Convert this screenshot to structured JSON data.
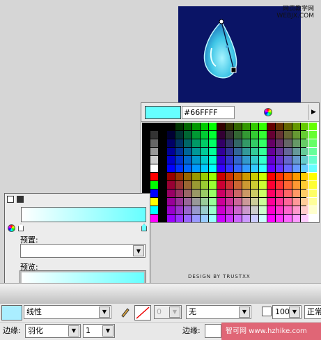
{
  "watermark_top": {
    "line1": "网页教学网",
    "line2": "WEBJX.COM"
  },
  "swatch_panel": {
    "hex_value": "#66FFFF",
    "preview_color": "#66ffff",
    "left_column_colors": [
      "#000000",
      "#333333",
      "#666666",
      "#999999",
      "#cccccc",
      "#ffffff",
      "#ff0000",
      "#00ff00",
      "#0000ff",
      "#ffff00",
      "#00ffff",
      "#ff00ff"
    ],
    "icons": {
      "wheel": "color-wheel-icon",
      "menu": "panel-menu-icon"
    }
  },
  "fill_panel": {
    "preset_label": "预置:",
    "preset_value": "",
    "preview_label": "预览:",
    "gradient_start": "#ffffff",
    "gradient_end": "#66ffff"
  },
  "design_credit": "DESIGN BY TRUSTXX",
  "toolbar": {
    "fill_type": "线性",
    "stroke_width": "0",
    "stroke_style": "无",
    "opacity": "100",
    "blend_mode": "正常",
    "edge_label": "边缘:",
    "edge_value": "羽化",
    "edge_amount": "1",
    "edge_label_right": "边缘:"
  },
  "bottom_watermark": "智可网  www.hzhike.com"
}
